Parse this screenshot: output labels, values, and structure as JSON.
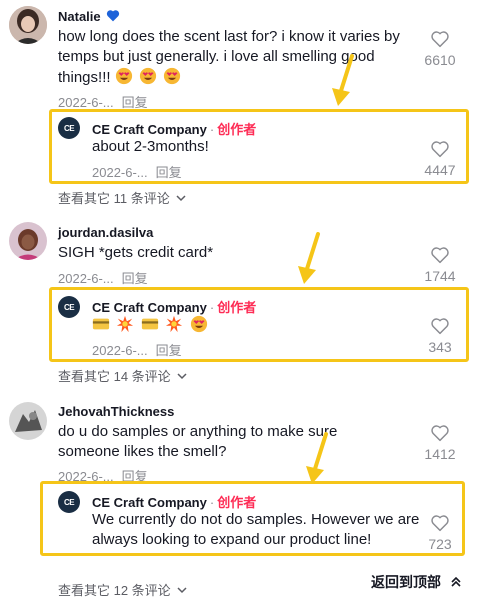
{
  "comments": [
    {
      "username": "Natalie",
      "text": "how long does the scent last for? i know it varies by temps but just generally. i love all smelling good things!!!",
      "date": "2022-6-...",
      "reply_label": "回复",
      "likes": "6610",
      "view_more": "查看其它 11 条评论",
      "reply": {
        "author": "CE Craft Company",
        "dot": "·",
        "creator_tag": "创作者",
        "text": "about 2-3months!",
        "date": "2022-6-...",
        "reply_label": "回复",
        "likes": "4447"
      }
    },
    {
      "username": "jourdan.dasilva",
      "text": "SIGH *gets credit card*",
      "date": "2022-6-...",
      "reply_label": "回复",
      "likes": "1744",
      "view_more": "查看其它 14 条评论",
      "reply": {
        "author": "CE Craft Company",
        "dot": "·",
        "creator_tag": "创作者",
        "text": "",
        "date": "2022-6-...",
        "reply_label": "回复",
        "likes": "343"
      }
    },
    {
      "username": "JehovahThickness",
      "text": "do u do samples or anything to make sure someone likes the smell?",
      "date": "2022-6-...",
      "reply_label": "回复",
      "likes": "1412",
      "view_more": "查看其它 12 条评论",
      "reply": {
        "author": "CE Craft Company",
        "dot": "·",
        "creator_tag": "创作者",
        "text": "We currently do not do samples. However we are always looking to expand our product line!",
        "date": "2022-6-...",
        "reply_label": "回复",
        "likes": "723"
      }
    }
  ],
  "back_to_top": "返回到顶部",
  "logo_text": "CE",
  "colors": {
    "highlight": "#f5c518",
    "creator": "#fe2c55",
    "muted": "#8a8b91"
  },
  "icons": [
    "heart-outline-icon",
    "chevron-down-icon",
    "verified-heart-icon",
    "smiling-face-with-heart-eyes-emoji",
    "credit-card-emoji",
    "collision-emoji",
    "double-chevron-up-icon"
  ]
}
